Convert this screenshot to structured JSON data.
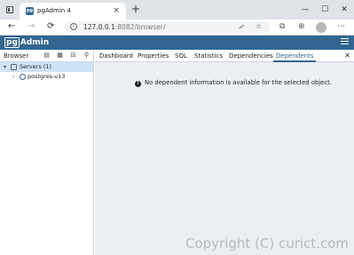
{
  "browser": {
    "tab_title": "pgAdmin 4",
    "favicon": "pg",
    "close_glyph": "×",
    "new_tab_glyph": "+",
    "window_controls": [
      "—",
      "☐",
      "✕"
    ],
    "url_host": "127.0.0.1",
    "url_rest": ":8082/browser/",
    "icons": {
      "back": "←",
      "forward": "→",
      "reload": "⟳",
      "read": "ꭿᴬ",
      "star": "☆",
      "collections": "⧉",
      "extensions": "⊕",
      "more": "⋯"
    }
  },
  "app": {
    "logo_pg": "pg",
    "logo_rest": "Admin"
  },
  "left_panel": {
    "title": "Browser",
    "tree": [
      {
        "label": "Servers (1)",
        "expanded": true,
        "selected": true
      },
      {
        "label": "postgres-v13",
        "expanded": false,
        "selected": false
      }
    ]
  },
  "right_panel": {
    "tabs": [
      "Dashboard",
      "Properties",
      "SQL",
      "Statistics",
      "Dependencies",
      "Dependents"
    ],
    "active_tab": "Dependents",
    "close_glyph": "✕",
    "message": "No dependent information is available for the selected object."
  },
  "watermark": "Copyright (C) curict.com",
  "colors": {
    "brand": "#326690",
    "selection": "#cfe3f7"
  }
}
